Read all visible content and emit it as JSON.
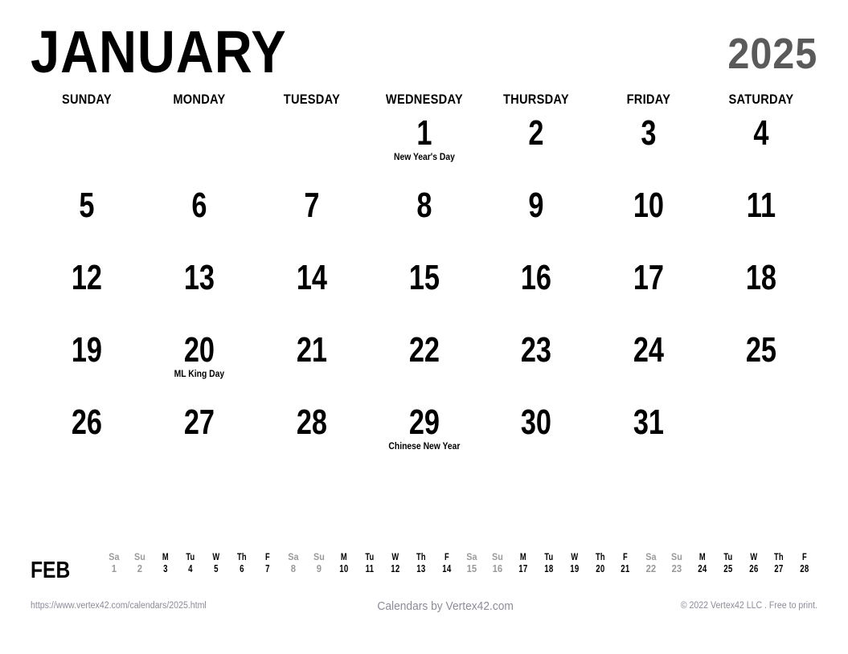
{
  "header": {
    "month": "JANUARY",
    "year": "2025",
    "year_color": "#5a5a5a"
  },
  "weekdays": [
    "SUNDAY",
    "MONDAY",
    "TUESDAY",
    "WEDNESDAY",
    "THURSDAY",
    "FRIDAY",
    "SATURDAY"
  ],
  "grid": {
    "cells": [
      {
        "day": "",
        "event": "",
        "empty": true
      },
      {
        "day": "",
        "event": "",
        "empty": true
      },
      {
        "day": "",
        "event": "",
        "empty": true
      },
      {
        "day": "1",
        "event": "New Year's Day",
        "empty": false
      },
      {
        "day": "2",
        "event": "",
        "empty": false
      },
      {
        "day": "3",
        "event": "",
        "empty": false
      },
      {
        "day": "4",
        "event": "",
        "empty": false
      },
      {
        "day": "5",
        "event": "",
        "empty": false
      },
      {
        "day": "6",
        "event": "",
        "empty": false
      },
      {
        "day": "7",
        "event": "",
        "empty": false
      },
      {
        "day": "8",
        "event": "",
        "empty": false
      },
      {
        "day": "9",
        "event": "",
        "empty": false
      },
      {
        "day": "10",
        "event": "",
        "empty": false
      },
      {
        "day": "11",
        "event": "",
        "empty": false
      },
      {
        "day": "12",
        "event": "",
        "empty": false
      },
      {
        "day": "13",
        "event": "",
        "empty": false
      },
      {
        "day": "14",
        "event": "",
        "empty": false
      },
      {
        "day": "15",
        "event": "",
        "empty": false
      },
      {
        "day": "16",
        "event": "",
        "empty": false
      },
      {
        "day": "17",
        "event": "",
        "empty": false
      },
      {
        "day": "18",
        "event": "",
        "empty": false
      },
      {
        "day": "19",
        "event": "",
        "empty": false
      },
      {
        "day": "20",
        "event": "ML King Day",
        "empty": false
      },
      {
        "day": "21",
        "event": "",
        "empty": false
      },
      {
        "day": "22",
        "event": "",
        "empty": false
      },
      {
        "day": "23",
        "event": "",
        "empty": false
      },
      {
        "day": "24",
        "event": "",
        "empty": false
      },
      {
        "day": "25",
        "event": "",
        "empty": false
      },
      {
        "day": "26",
        "event": "",
        "empty": false
      },
      {
        "day": "27",
        "event": "",
        "empty": false
      },
      {
        "day": "28",
        "event": "",
        "empty": false
      },
      {
        "day": "29",
        "event": "Chinese New Year",
        "empty": false
      },
      {
        "day": "30",
        "event": "",
        "empty": false
      },
      {
        "day": "31",
        "event": "",
        "empty": false
      },
      {
        "day": "",
        "event": "",
        "empty": true
      }
    ]
  },
  "mini_strip": {
    "label": "FEB",
    "weekend_color": "#9a9a9a",
    "weekday_color": "#000000",
    "days": [
      {
        "dow": "Sa",
        "num": "1",
        "weekend": true
      },
      {
        "dow": "Su",
        "num": "2",
        "weekend": true
      },
      {
        "dow": "M",
        "num": "3",
        "weekend": false
      },
      {
        "dow": "Tu",
        "num": "4",
        "weekend": false
      },
      {
        "dow": "W",
        "num": "5",
        "weekend": false
      },
      {
        "dow": "Th",
        "num": "6",
        "weekend": false
      },
      {
        "dow": "F",
        "num": "7",
        "weekend": false
      },
      {
        "dow": "Sa",
        "num": "8",
        "weekend": true
      },
      {
        "dow": "Su",
        "num": "9",
        "weekend": true
      },
      {
        "dow": "M",
        "num": "10",
        "weekend": false
      },
      {
        "dow": "Tu",
        "num": "11",
        "weekend": false
      },
      {
        "dow": "W",
        "num": "12",
        "weekend": false
      },
      {
        "dow": "Th",
        "num": "13",
        "weekend": false
      },
      {
        "dow": "F",
        "num": "14",
        "weekend": false
      },
      {
        "dow": "Sa",
        "num": "15",
        "weekend": true
      },
      {
        "dow": "Su",
        "num": "16",
        "weekend": true
      },
      {
        "dow": "M",
        "num": "17",
        "weekend": false
      },
      {
        "dow": "Tu",
        "num": "18",
        "weekend": false
      },
      {
        "dow": "W",
        "num": "19",
        "weekend": false
      },
      {
        "dow": "Th",
        "num": "20",
        "weekend": false
      },
      {
        "dow": "F",
        "num": "21",
        "weekend": false
      },
      {
        "dow": "Sa",
        "num": "22",
        "weekend": true
      },
      {
        "dow": "Su",
        "num": "23",
        "weekend": true
      },
      {
        "dow": "M",
        "num": "24",
        "weekend": false
      },
      {
        "dow": "Tu",
        "num": "25",
        "weekend": false
      },
      {
        "dow": "W",
        "num": "26",
        "weekend": false
      },
      {
        "dow": "Th",
        "num": "27",
        "weekend": false
      },
      {
        "dow": "F",
        "num": "28",
        "weekend": false
      }
    ]
  },
  "footer": {
    "left": "https://www.vertex42.com/calendars/2025.html",
    "center": "Calendars by Vertex42.com",
    "right": "© 2022 Vertex42 LLC . Free to print."
  }
}
